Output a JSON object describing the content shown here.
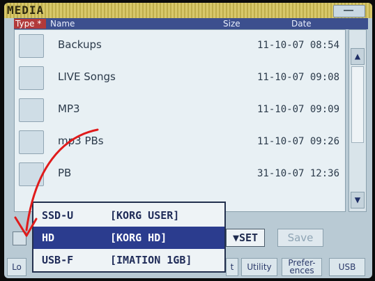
{
  "window": {
    "title": "MEDIA"
  },
  "header": {
    "type": "Type",
    "star": "*",
    "name": "Name",
    "size": "Size",
    "date": "Date"
  },
  "files": [
    {
      "name": "Backups",
      "date": "11-10-07 08:54"
    },
    {
      "name": "LIVE Songs",
      "date": "11-10-07 09:08"
    },
    {
      "name": "MP3",
      "date": "11-10-07 09:09"
    },
    {
      "name": "mp3 PBs",
      "date": "11-10-07 09:26"
    },
    {
      "name": "PB",
      "date": "31-10-07 12:36"
    }
  ],
  "buttons": {
    "set": "▼SET",
    "save": "Save"
  },
  "tabs": {
    "load": "Lo",
    "t": "t",
    "utility": "Utility",
    "preferences_1": "Prefer-",
    "preferences_2": "ences",
    "usb": "USB"
  },
  "devices": [
    {
      "device": "SSD-U",
      "label": "[KORG USER]"
    },
    {
      "device": "HD",
      "label": "[KORG HD]",
      "selected": true
    },
    {
      "device": "USB-F",
      "label": "[IMATION 1GB]"
    }
  ],
  "colors": {
    "selection": "#2b3c8e",
    "header": "#3c4f8e",
    "type_tag": "#b23a3a",
    "annotation_arrow": "#e01b1b"
  }
}
